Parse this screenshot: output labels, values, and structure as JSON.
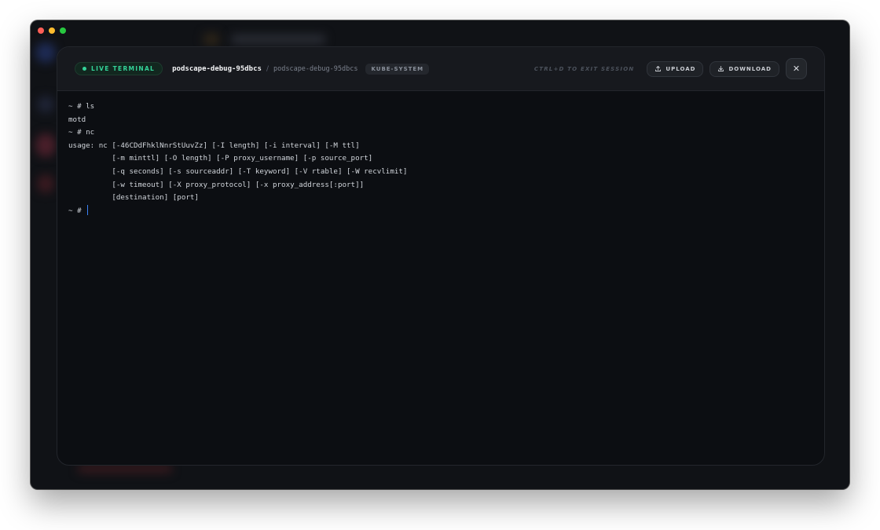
{
  "window": {
    "traffic_lights": [
      "close",
      "minimize",
      "zoom"
    ]
  },
  "terminal_modal": {
    "live_badge": "LIVE TERMINAL",
    "pod_name": "podscape-debug-95dbcs",
    "separator": "/",
    "container_name": "podscape-debug-95dbcs",
    "namespace": "KUBE-SYSTEM",
    "exit_hint": "CTRL+D TO EXIT SESSION",
    "upload_label": "UPLOAD",
    "download_label": "DOWNLOAD",
    "close_glyph": "✕",
    "lines": [
      "~ # ls",
      "motd",
      "~ # nc",
      "usage: nc [-46CDdFhklNnrStUuvZz] [-I length] [-i interval] [-M ttl]",
      "          [-m minttl] [-O length] [-P proxy_username] [-p source_port]",
      "          [-q seconds] [-s sourceaddr] [-T keyword] [-V rtable] [-W recvlimit]",
      "          [-w timeout] [-X proxy_protocol] [-x proxy_address[:port]]",
      "          [destination] [port]"
    ],
    "prompt": "~ # "
  },
  "colors": {
    "accent_live": "#34d399",
    "cursor": "#3b82f6",
    "background": "#0c0e12"
  }
}
